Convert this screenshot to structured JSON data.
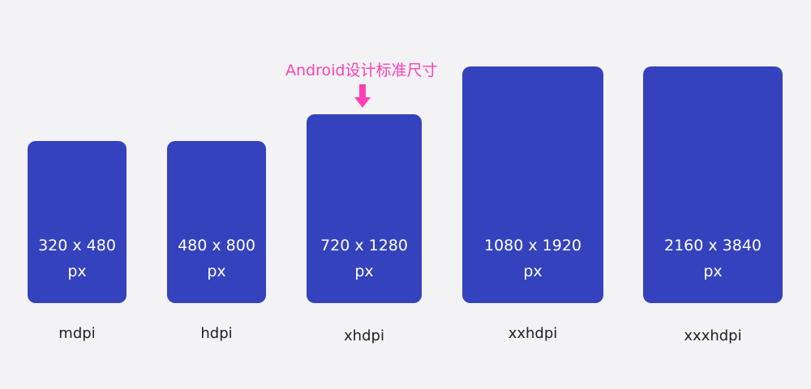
{
  "callout": {
    "text": "Android设计标准尺寸",
    "color": "#ff3fb5"
  },
  "device_color": "#3442be",
  "devices": [
    {
      "resolution": "320 x 480",
      "unit": "px",
      "density": "mdpi"
    },
    {
      "resolution": "480 x 800",
      "unit": "px",
      "density": "hdpi"
    },
    {
      "resolution": "720 x 1280",
      "unit": "px",
      "density": "xhdpi"
    },
    {
      "resolution": "1080 x 1920",
      "unit": "px",
      "density": "xxhdpi"
    },
    {
      "resolution": "2160 x 3840",
      "unit": "px",
      "density": "xxxhdpi"
    }
  ]
}
